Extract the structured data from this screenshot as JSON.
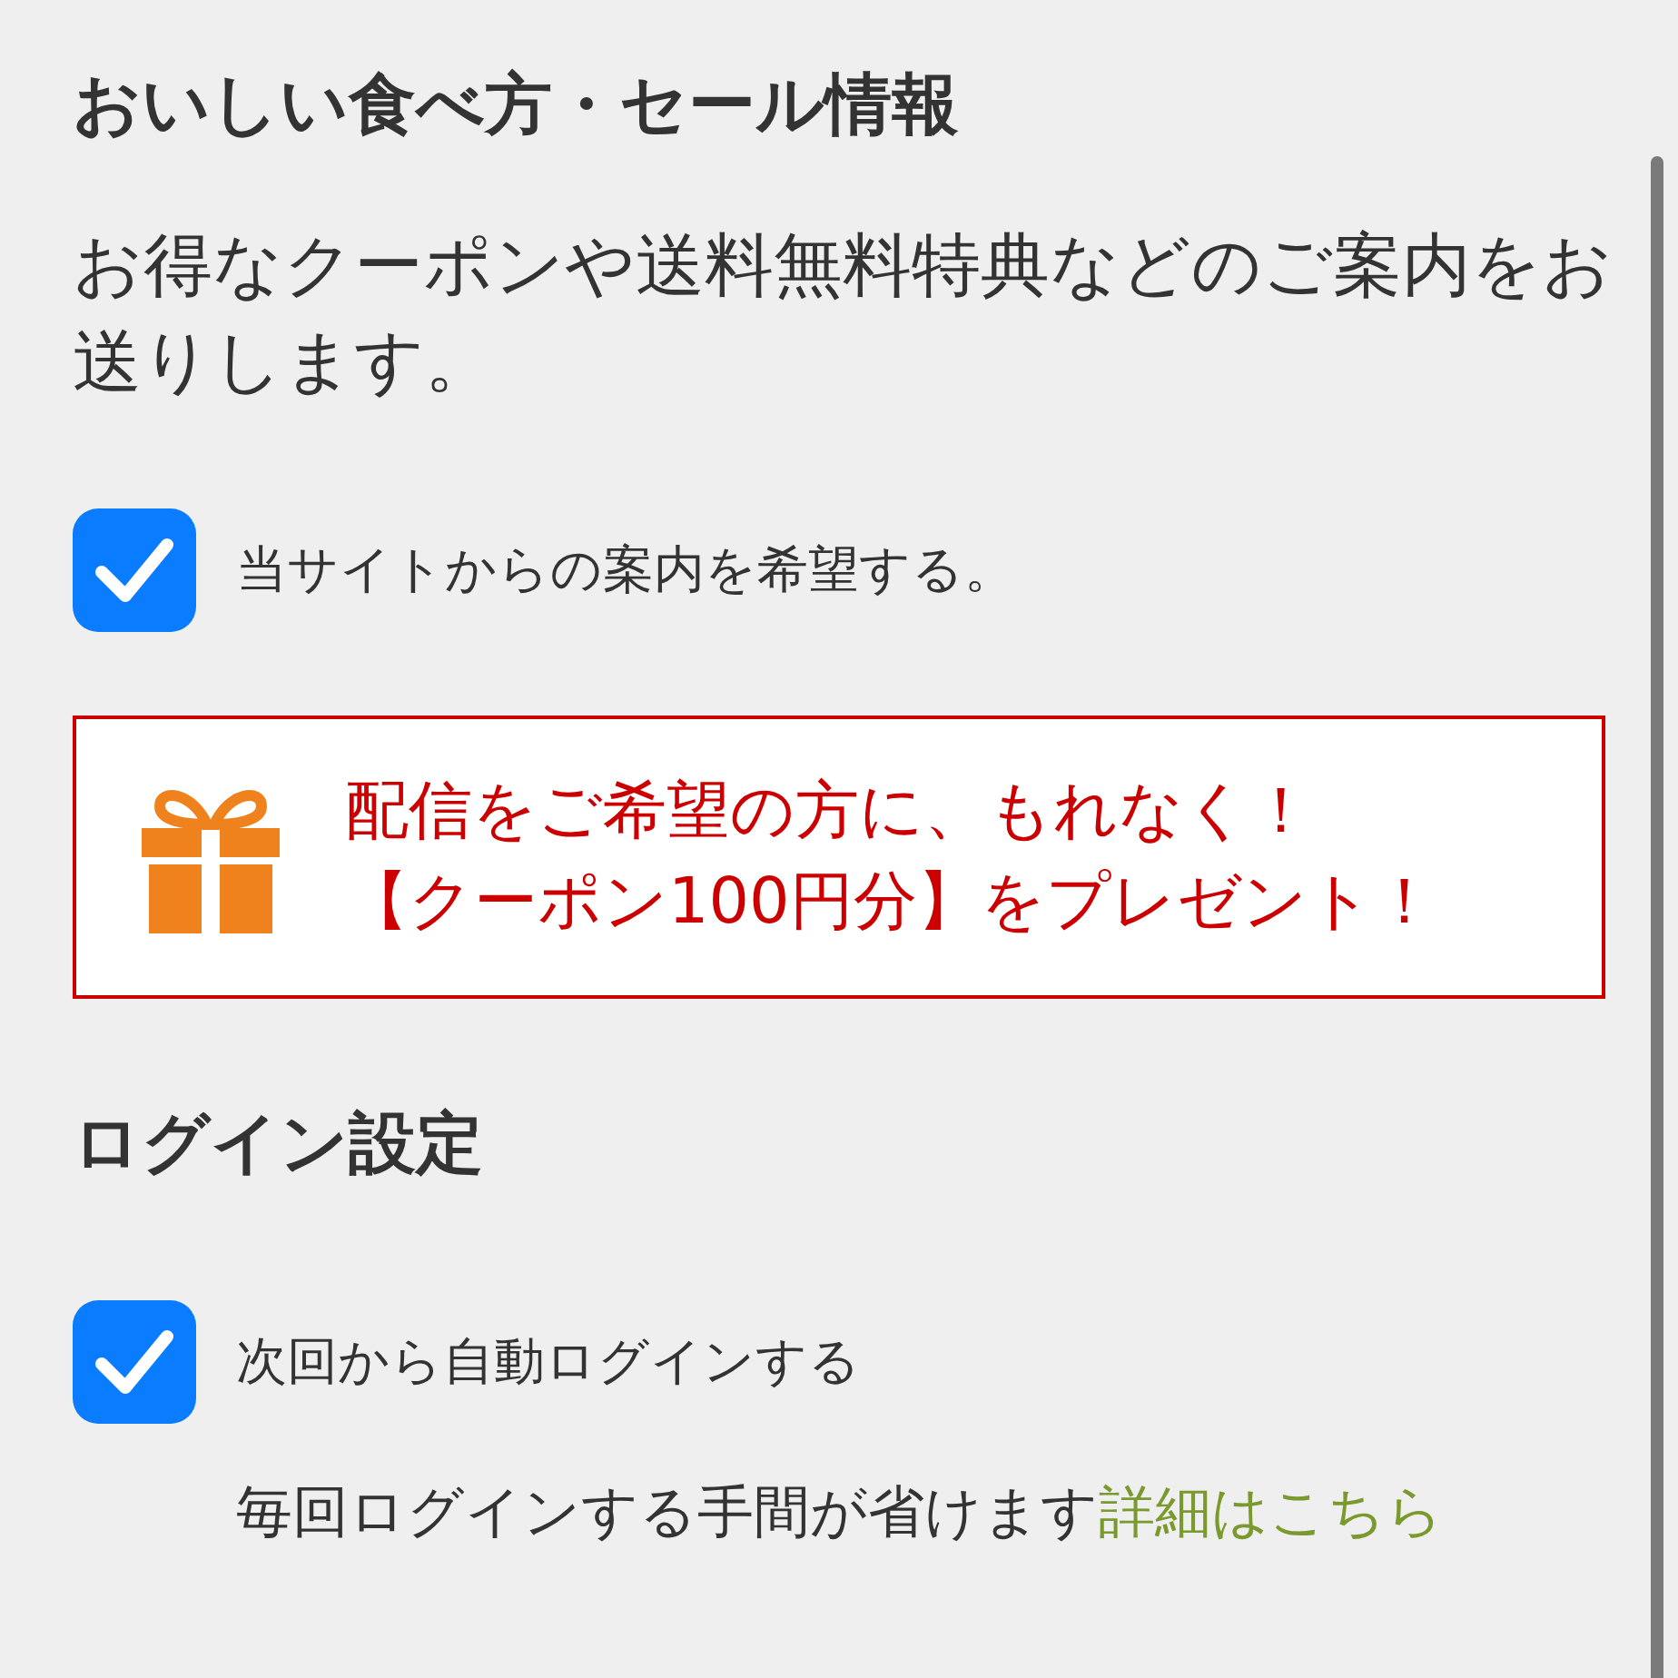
{
  "sections": [
    {
      "title": "おいしい食べ方・セール情報",
      "description": "お得なクーポンや送料無料特典などのご案内をお送りします。",
      "options": [
        {
          "label": "当サイトからの案内を希望する。",
          "checked": true
        }
      ],
      "promo": {
        "lines": [
          "配信をご希望の方に、もれなく！",
          "【クーポン100円分】をプレゼント！"
        ]
      }
    },
    {
      "title": "ログイン設定",
      "options": [
        {
          "label": "次回から自動ログインする",
          "checked": true
        }
      ],
      "note": {
        "text": "毎回ログインする手間が省けます",
        "link": "詳細はこちら"
      }
    }
  ]
}
